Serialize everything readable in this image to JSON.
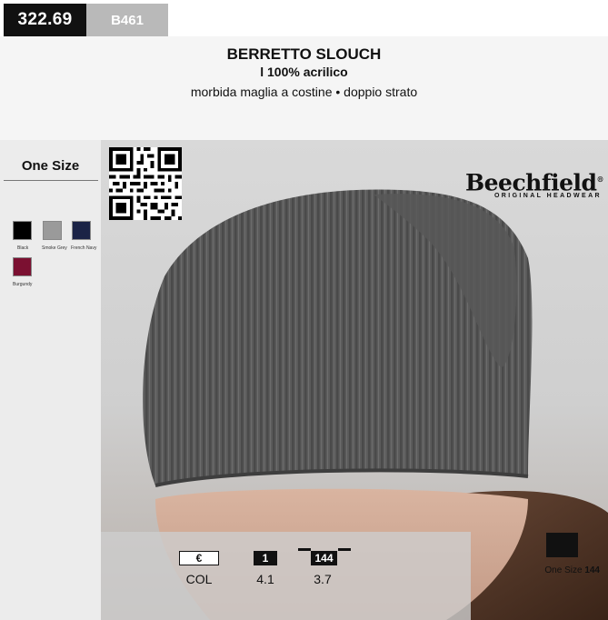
{
  "header": {
    "code": "322.69",
    "ref": "B461",
    "title": "BERRETTO SLOUCH",
    "material": "l 100% acrilico",
    "description": "morbida maglia a costine • doppio strato"
  },
  "sidebar": {
    "size_label": "One Size",
    "colors": [
      {
        "name": "Black",
        "hex": "#000000"
      },
      {
        "name": "Smoke Grey",
        "hex": "#9a9a9a"
      },
      {
        "name": "French Navy",
        "hex": "#1b2346"
      },
      {
        "name": "Burgundy",
        "hex": "#7b1031"
      }
    ]
  },
  "brand": {
    "name": "Beechfield",
    "tagline": "ORIGINAL HEADWEAR",
    "mark": "®"
  },
  "info": {
    "euro_label": "€",
    "col_label": "COL",
    "qty_box": "1",
    "qty_value": "4.1",
    "carton_box": "144",
    "carton_value": "3.7"
  },
  "size_icon": {
    "label": "One Size",
    "qty": "144"
  },
  "icons": {
    "qr": "qr-code-icon",
    "garment": "garment-icon"
  }
}
